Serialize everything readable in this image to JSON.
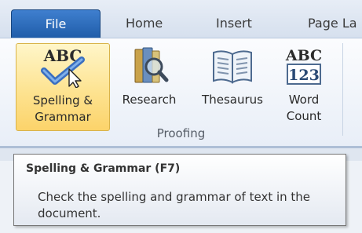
{
  "tabs": {
    "file": "File",
    "home": "Home",
    "insert": "Insert",
    "page_layout": "Page La"
  },
  "ribbon": {
    "buttons": [
      {
        "line1": "Spelling &",
        "line2": "Grammar",
        "icon": "spelling-check-icon"
      },
      {
        "line1": "Research",
        "line2": "",
        "icon": "research-icon"
      },
      {
        "line1": "Thesaurus",
        "line2": "",
        "icon": "thesaurus-icon"
      },
      {
        "line1": "Word",
        "line2": "Count",
        "icon": "word-count-icon"
      }
    ],
    "spelling_icon_text": "ABC",
    "word_count_icon_top": "ABC",
    "word_count_icon_bottom": "123",
    "group_label": "Proofing"
  },
  "tooltip": {
    "title": "Spelling & Grammar (F7)",
    "body": "Check the spelling and grammar of text in the document."
  },
  "colors": {
    "file_tab": "#2b6cbf",
    "hover": "#fde391",
    "checkmark": "#3a6fc0"
  }
}
